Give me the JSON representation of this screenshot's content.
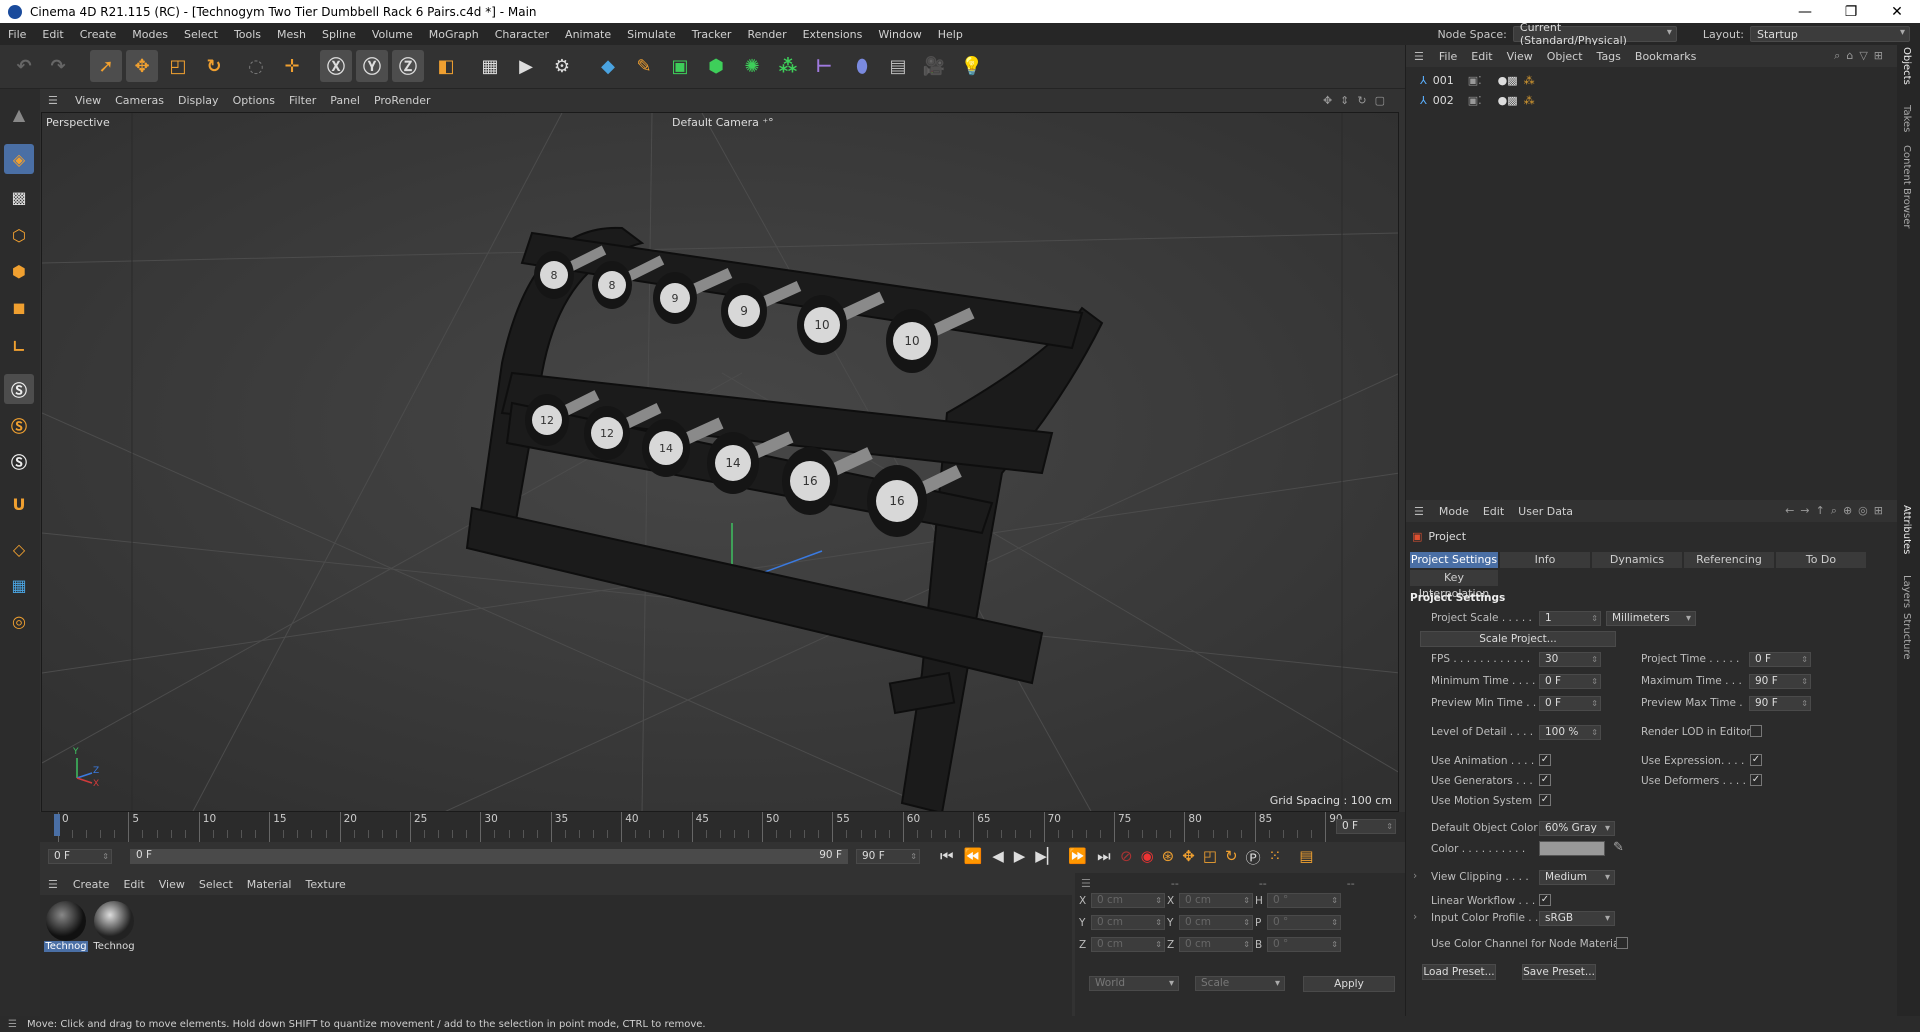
{
  "window": {
    "title": "Cinema 4D R21.115 (RC) - [Technogym Two Tier Dumbbell Rack 6 Pairs.c4d *] - Main"
  },
  "menu": [
    "File",
    "Edit",
    "Create",
    "Modes",
    "Select",
    "Tools",
    "Mesh",
    "Spline",
    "Volume",
    "MoGraph",
    "Character",
    "Animate",
    "Simulate",
    "Tracker",
    "Render",
    "Extensions",
    "Window",
    "Help"
  ],
  "nodespace": {
    "label": "Node Space:",
    "value": "Current (Standard/Physical)"
  },
  "layout": {
    "label": "Layout:",
    "value": "Startup"
  },
  "viewport": {
    "menu": [
      "View",
      "Cameras",
      "Display",
      "Options",
      "Filter",
      "Panel",
      "ProRender"
    ],
    "label": "Perspective",
    "camera": "Default Camera",
    "grid": "Grid Spacing : 100 cm",
    "top_plates": [
      "8",
      "8",
      "9",
      "9",
      "10",
      "10"
    ],
    "bottom_plates": [
      "12",
      "12",
      "14",
      "14",
      "16",
      "16"
    ],
    "axis": {
      "y": "Y",
      "z": "Z",
      "x": "X"
    }
  },
  "timeline": {
    "ticks": [
      "0",
      "5",
      "10",
      "15",
      "20",
      "25",
      "30",
      "35",
      "40",
      "45",
      "50",
      "55",
      "60",
      "65",
      "70",
      "75",
      "80",
      "85",
      "90"
    ],
    "current": "0 F"
  },
  "transport": {
    "start": "0 F",
    "slider_start": "0 F",
    "slider_end": "90 F",
    "end": "90 F"
  },
  "materials": {
    "menu": [
      "Create",
      "Edit",
      "View",
      "Select",
      "Material",
      "Texture"
    ],
    "items": [
      "Technog",
      "Technog"
    ]
  },
  "coords": {
    "header": [
      "--",
      "--",
      "--"
    ],
    "rows": [
      {
        "a": "X",
        "av": "0 cm",
        "b": "X",
        "bv": "0 cm",
        "c": "H",
        "cv": "0 °"
      },
      {
        "a": "Y",
        "av": "0 cm",
        "b": "Y",
        "bv": "0 cm",
        "c": "P",
        "cv": "0 °"
      },
      {
        "a": "Z",
        "av": "0 cm",
        "b": "Z",
        "bv": "0 cm",
        "c": "B",
        "cv": "0 °"
      }
    ],
    "world": "World",
    "scale": "Scale",
    "apply": "Apply"
  },
  "objects": {
    "menu": [
      "File",
      "Edit",
      "View",
      "Object",
      "Tags",
      "Bookmarks"
    ],
    "items": [
      "001",
      "002"
    ]
  },
  "attributes": {
    "menu": [
      "Mode",
      "Edit",
      "User Data"
    ],
    "title": "Project",
    "tabs": [
      "Project Settings",
      "Info",
      "Dynamics",
      "Referencing",
      "To Do"
    ],
    "tab2": "Key Interpolation",
    "section": "Project Settings",
    "project_scale": {
      "label": "Project Scale . . . . .",
      "value": "1",
      "unit": "Millimeters"
    },
    "scale_btn": "Scale Project...",
    "fps": {
      "label": "FPS . . . . . . . . . . . .",
      "value": "30"
    },
    "project_time": {
      "label": "Project Time . . . . .",
      "value": "0 F"
    },
    "min_time": {
      "label": "Minimum Time . . . .",
      "value": "0 F"
    },
    "max_time": {
      "label": "Maximum Time . . .",
      "value": "90 F"
    },
    "pmin_time": {
      "label": "Preview Min Time . .",
      "value": "0 F"
    },
    "pmax_time": {
      "label": "Preview Max Time .",
      "value": "90 F"
    },
    "lod": {
      "label": "Level of Detail . . . .",
      "value": "100 %"
    },
    "render_lod": "Render LOD in Editor",
    "use_anim": "Use Animation . . . .",
    "use_expr": "Use Expression. . . .",
    "use_gen": "Use Generators . . .",
    "use_def": "Use Deformers . . . .",
    "use_motion": "Use Motion System",
    "def_color": {
      "label": "Default Object Color",
      "value": "60% Gray"
    },
    "color": {
      "label": "Color . . . . . . . . . .",
      "swatch": "#999999"
    },
    "view_clip": {
      "label": "View Clipping . . . .",
      "value": "Medium"
    },
    "linear": "Linear Workflow . . .",
    "input_profile": {
      "label": "Input Color Profile . .",
      "value": "sRGB"
    },
    "use_color_channel": "Use Color Channel for Node Material",
    "load_preset": "Load Preset...",
    "save_preset": "Save Preset..."
  },
  "sidetabs": [
    "Objects",
    "Takes",
    "Content Browser",
    "Attributes",
    "Layers",
    "Structure"
  ],
  "status": "Move: Click and drag to move elements. Hold down SHIFT to quantize movement / add to the selection in point mode, CTRL to remove."
}
